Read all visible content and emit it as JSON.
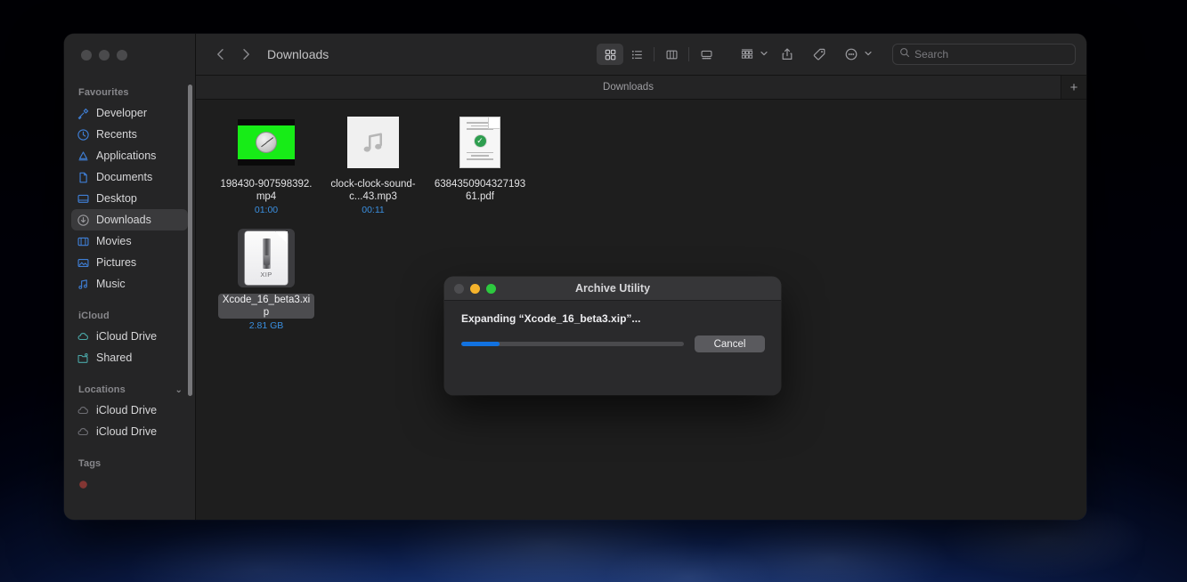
{
  "desktop": {
    "wallpaper_name": "earth-from-space-wallpaper"
  },
  "finder": {
    "window_title": "Downloads",
    "traffic_lights": [
      "close",
      "minimize",
      "zoom"
    ],
    "toolbar": {
      "back_icon": "chevron-left-icon",
      "forward_icon": "chevron-right-icon",
      "path_title": "Downloads",
      "view_icon_grid": "icon-view-icon",
      "view_icon_list": "list-view-icon",
      "view_icon_column": "column-view-icon",
      "view_icon_gallery": "gallery-view-icon",
      "group_icon": "group-by-icon",
      "share_icon": "share-icon",
      "tag_icon": "tag-icon",
      "more_icon": "more-actions-icon",
      "chevron_icon": "chevron-down-icon"
    },
    "search": {
      "placeholder": "Search",
      "value": "",
      "icon": "search-icon"
    },
    "tabs": {
      "active_label": "Downloads",
      "add_label": "+"
    },
    "sidebar": {
      "sections": [
        {
          "title": "Favourites",
          "collapsible": false,
          "chevron": "",
          "items": [
            {
              "label": "Developer",
              "icon": "hammer-icon",
              "selected": false
            },
            {
              "label": "Recents",
              "icon": "clock-icon",
              "selected": false
            },
            {
              "label": "Applications",
              "icon": "applications-icon",
              "selected": false
            },
            {
              "label": "Documents",
              "icon": "document-icon",
              "selected": false
            },
            {
              "label": "Desktop",
              "icon": "desktop-icon",
              "selected": false
            },
            {
              "label": "Downloads",
              "icon": "downloads-icon",
              "selected": true
            },
            {
              "label": "Movies",
              "icon": "movies-icon",
              "selected": false
            },
            {
              "label": "Pictures",
              "icon": "pictures-icon",
              "selected": false
            },
            {
              "label": "Music",
              "icon": "music-icon",
              "selected": false
            }
          ]
        },
        {
          "title": "iCloud",
          "collapsible": false,
          "chevron": "",
          "items": [
            {
              "label": "iCloud Drive",
              "icon": "cloud-icon",
              "selected": false
            },
            {
              "label": "Shared",
              "icon": "shared-folder-icon",
              "selected": false
            }
          ]
        },
        {
          "title": "Locations",
          "collapsible": true,
          "chevron": "⌄",
          "items": [
            {
              "label": "iCloud Drive",
              "icon": "cloud-icon",
              "selected": false
            },
            {
              "label": "iCloud Drive",
              "icon": "cloud-icon",
              "selected": false
            }
          ]
        },
        {
          "title": "Tags",
          "collapsible": false,
          "chevron": "",
          "items": []
        }
      ]
    },
    "files": [
      {
        "name": "198430-907598392.mp4",
        "subtitle": "01:00",
        "thumb": "video-thumbnail-green-clock",
        "selected": false
      },
      {
        "name": "clock-clock-sound-c...43.mp3",
        "subtitle": "00:11",
        "thumb": "audio-music-note-thumbnail",
        "selected": false
      },
      {
        "name": "638435090432719361.pdf",
        "subtitle": "",
        "thumb": "pdf-document-thumbnail",
        "selected": false
      },
      {
        "name": "Xcode_16_beta3.xip",
        "subtitle": "2.81 GB",
        "thumb": "xip-archive-thumbnail",
        "thumb_label": "XIP",
        "selected": true
      }
    ]
  },
  "archive_dialog": {
    "title": "Archive Utility",
    "status_text": "Expanding “Xcode_16_beta3.xip”...",
    "progress_percent": 17,
    "cancel_label": "Cancel",
    "traffic_lights": [
      "close-disabled",
      "minimize",
      "zoom"
    ],
    "accent_color": "#1272e0"
  }
}
